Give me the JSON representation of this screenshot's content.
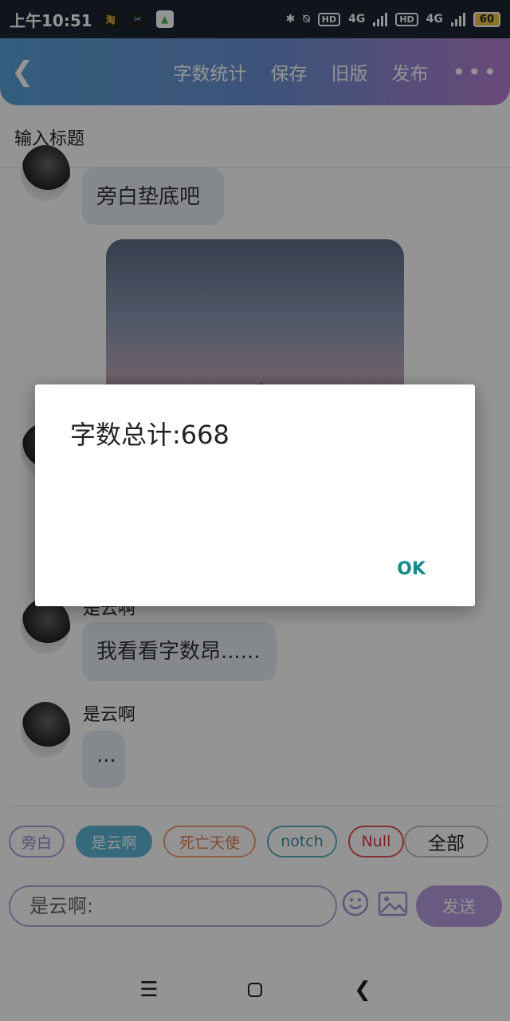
{
  "status_bar": {
    "time": "上午10:51",
    "apps": [
      "淘",
      "✂",
      "▲"
    ],
    "hd1": "HD",
    "net1": "4G",
    "hd2": "HD",
    "net2": "4G",
    "battery": "60"
  },
  "topbar": {
    "word_count": "字数统计",
    "save": "保存",
    "old_version": "旧版",
    "publish": "发布",
    "more": "•••"
  },
  "title_placeholder": "输入标题",
  "messages": [
    {
      "text": "旁白垫底吧"
    },
    {
      "name": "是云啊",
      "text": "我看看字数昂......"
    },
    {
      "name": "是云啊",
      "text": "..."
    }
  ],
  "tags": [
    {
      "label": "旁白",
      "color": "#b59be0",
      "text_color": "#9a86c7"
    },
    {
      "label": "是云啊",
      "color": "#5fb6d8",
      "text_color": "#ffffff",
      "fill": "#5fb6d8"
    },
    {
      "label": "死亡天使",
      "color": "#f1a173",
      "text_color": "#e07f55"
    },
    {
      "label": "notch",
      "color": "#5aaec0",
      "text_color": "#3a8ea0"
    },
    {
      "label": "Null",
      "color": "#e05555",
      "text_color": "#d04444"
    },
    {
      "label": "全部",
      "color": "#bdbdbd",
      "text_color": "#222222"
    }
  ],
  "composer": {
    "placeholder": "是云啊:",
    "send": "发送"
  },
  "dialog": {
    "message": "字数总计:668",
    "ok": "OK"
  }
}
